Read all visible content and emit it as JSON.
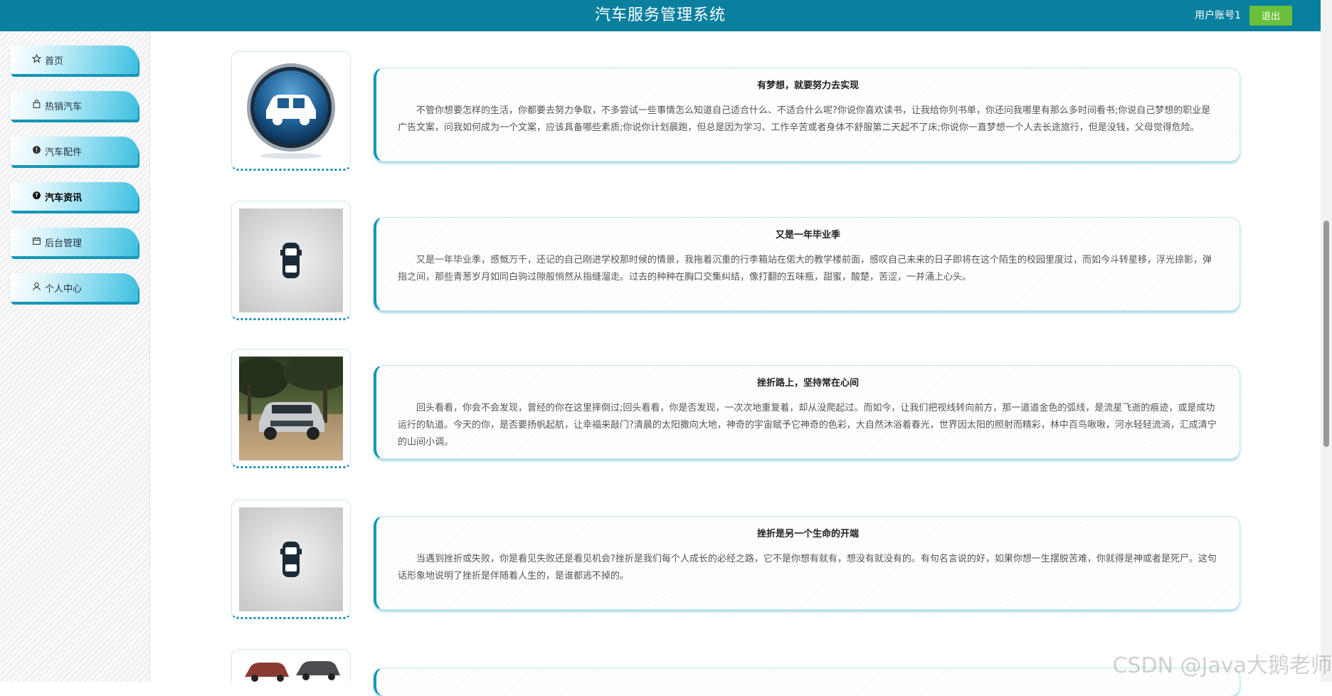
{
  "header": {
    "title": "汽车服务管理系统",
    "account": "用户账号1",
    "logout_label": "退出",
    "bg_color": "#0a7f9e"
  },
  "sidebar": {
    "items": [
      {
        "label": "首页",
        "icon": "star-icon"
      },
      {
        "label": "热销汽车",
        "icon": "bag-icon"
      },
      {
        "label": "汽车配件",
        "icon": "info-circle-icon"
      },
      {
        "label": "汽车资讯",
        "icon": "question-circle-icon",
        "active": true
      },
      {
        "label": "后台管理",
        "icon": "calendar-icon"
      },
      {
        "label": "个人中心",
        "icon": "user-icon"
      }
    ]
  },
  "news": [
    {
      "title": "有梦想，就要努力去实现",
      "body": "不管你想要怎样的生活，你都要去努力争取，不多尝试一些事情怎么知道自己适合什么、不适合什么呢?你说你喜欢读书，让我给你列书单，你还问我哪里有那么多时间看书;你说自己梦想的职业是广告文案，问我如何成为一个文案，应该具备哪些素质;你说你计划晨跑，但总是因为学习、工作辛苦或者身体不舒服第二天起不了床;你说你一直梦想一个人去长途旅行，但是没钱，父母觉得危险。",
      "image": "car-button-icon"
    },
    {
      "title": "又是一年毕业季",
      "body": "又是一年毕业季，感慨万千，还记的自己刚进学校那时候的情景，我拖着沉重的行李箱站在偌大的教学楼前面，感叹自己未来的日子即将在这个陌生的校园里度过，而如今斗转星移，浮光掠影，弹指之间，那些青葱岁月如同白驹过隙般悄然从指缝溜走。过去的种种在胸口交集纠结，像打翻的五味瓶，甜蜜，酸楚，苦涩，一并涌上心头。",
      "image": "car-topview-icon"
    },
    {
      "title": "挫折路上，坚持常在心间",
      "body": "回头看看，你会不会发现，曾经的你在这里摔倒过;回头看看，你是否发现，一次次地重复着，却从没爬起过。而如今，让我们把视线转向前方，那一道道金色的弧线，是流星飞逝的痕迹，或是成功运行的轨道。今天的你，是否要扬帆起航，让幸福来敲门?清晨的太阳撒向大地，神奇的宇宙赋予它神奇的色彩，大自然沐浴着春光，世界因太阳的照射而精彩，林中百鸟啾啾，河水轻轻流淌，汇成清宁的山间小调。",
      "image": "suv-photo"
    },
    {
      "title": "挫折是另一个生命的开端",
      "body": "当遇到挫折或失败，你是看见失败还是看见机会?挫折是我们每个人成长的必经之路，它不是你想有就有，想没有就没有的。有句名言说的好，如果你想一生摆脱苦难，你就得是神或者是死尸。这句话形象地说明了挫折是伴随着人生的，是谁都逃不掉的。",
      "image": "car-topview-icon"
    }
  ],
  "partial_next_item": {
    "image": "car-parts-photo"
  },
  "watermark": "CSDN @Java大鹅老师"
}
